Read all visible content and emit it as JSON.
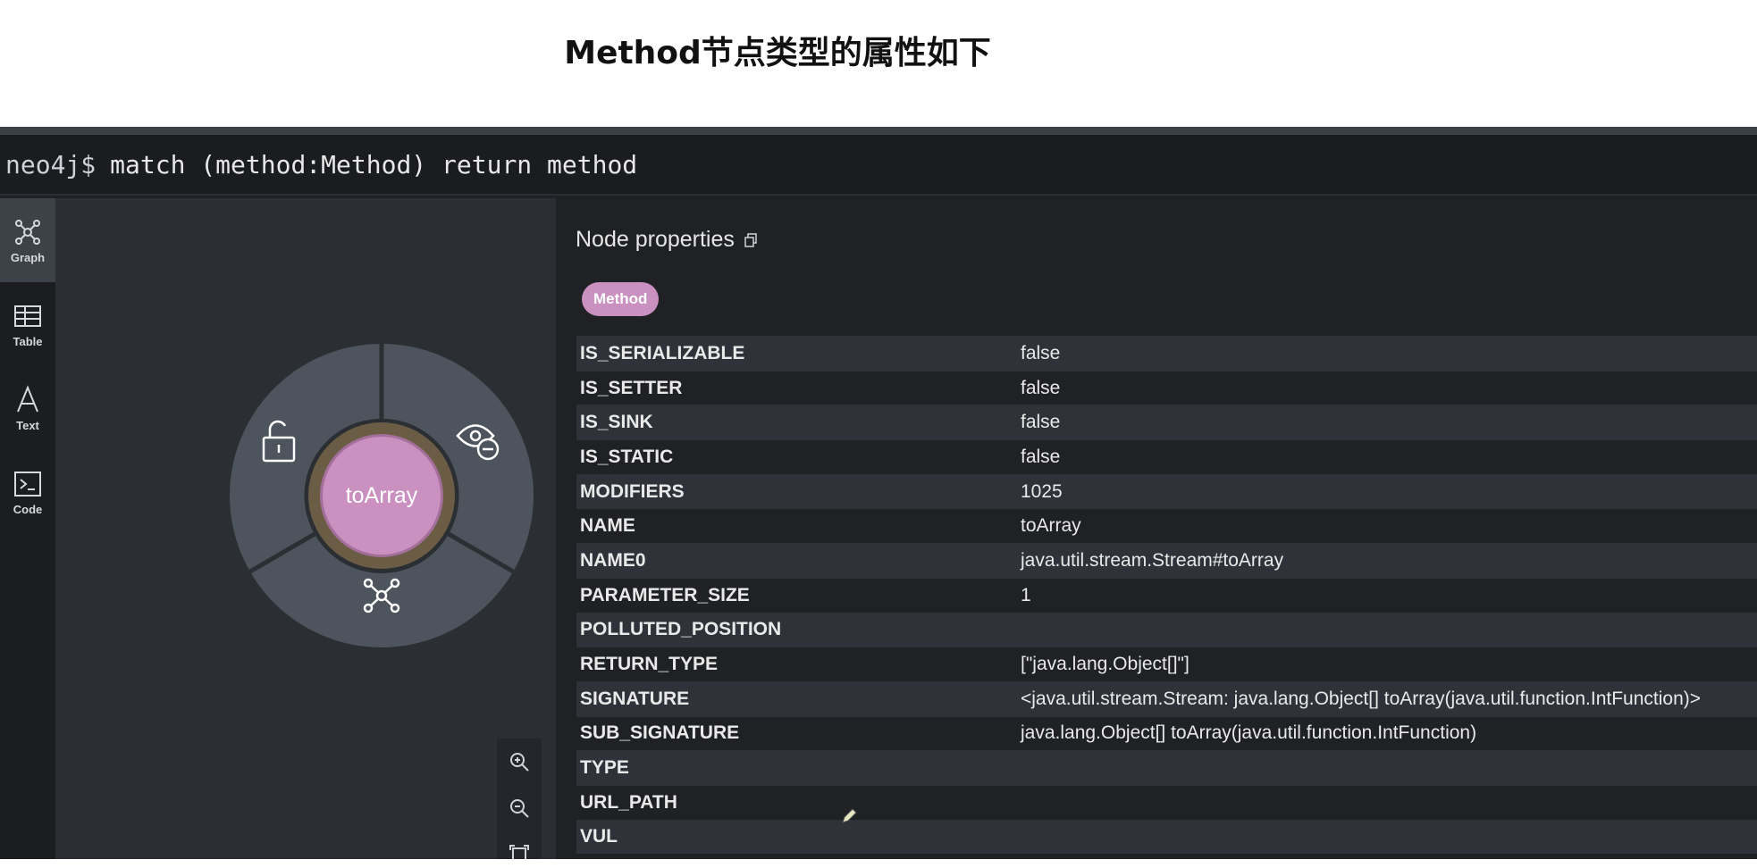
{
  "heading": "Method节点类型的属性如下",
  "command": {
    "prompt": "neo4j$",
    "query": "match (method:Method) return method"
  },
  "sidebar": {
    "items": [
      {
        "label": "Graph",
        "icon": "graph-icon",
        "active": true
      },
      {
        "label": "Table",
        "icon": "table-icon",
        "active": false
      },
      {
        "label": "Text",
        "icon": "text-icon",
        "active": false
      },
      {
        "label": "Code",
        "icon": "code-icon",
        "active": false
      }
    ]
  },
  "node": {
    "label": "toArray",
    "ring_actions": [
      "unlock-icon",
      "hide-icon",
      "expand-icon"
    ],
    "fill": "#c990c0",
    "ring": "#6b5d45"
  },
  "panel": {
    "title": "Node properties",
    "badge": "Method",
    "properties": [
      {
        "key": "IS_SERIALIZABLE",
        "value": "false"
      },
      {
        "key": "IS_SETTER",
        "value": "false"
      },
      {
        "key": "IS_SINK",
        "value": "false"
      },
      {
        "key": "IS_STATIC",
        "value": "false"
      },
      {
        "key": "MODIFIERS",
        "value": "1025"
      },
      {
        "key": "NAME",
        "value": "toArray"
      },
      {
        "key": "NAME0",
        "value": "java.util.stream.Stream#toArray"
      },
      {
        "key": "PARAMETER_SIZE",
        "value": "1"
      },
      {
        "key": "POLLUTED_POSITION",
        "value": ""
      },
      {
        "key": "RETURN_TYPE",
        "value": "[\"java.lang.Object[]\"]"
      },
      {
        "key": "SIGNATURE",
        "value": "<java.util.stream.Stream: java.lang.Object[] toArray(java.util.function.IntFunction)>"
      },
      {
        "key": "SUB_SIGNATURE",
        "value": "java.lang.Object[] toArray(java.util.function.IntFunction)"
      },
      {
        "key": "TYPE",
        "value": ""
      },
      {
        "key": "URL_PATH",
        "value": ""
      },
      {
        "key": "VUL",
        "value": ""
      }
    ]
  },
  "zoom": [
    "zoom-in-icon",
    "zoom-out-icon",
    "fit-icon"
  ]
}
